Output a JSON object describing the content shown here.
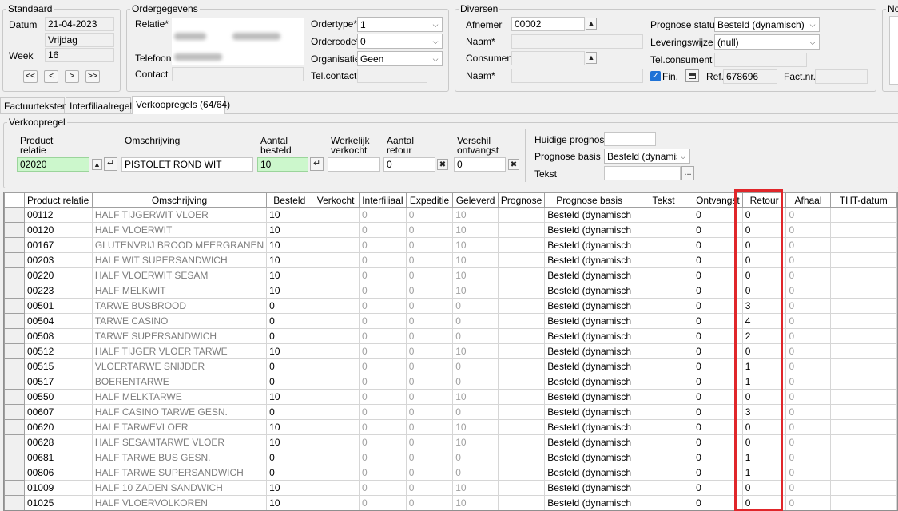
{
  "standaard": {
    "title": "Standaard",
    "datum_label": "Datum",
    "datum_value": "21-04-2023",
    "day_value": "Vrijdag",
    "week_label": "Week",
    "week_value": "16",
    "nav": [
      "<<",
      "<",
      ">",
      ">>"
    ]
  },
  "ordergegevens": {
    "title": "Ordergegevens",
    "relatie_label": "Relatie*",
    "telefoon_label": "Telefoon",
    "contact_label": "Contact",
    "ordertype_label": "Ordertype*",
    "ordertype_value": "1",
    "ordercode_label": "Ordercode*",
    "ordercode_value": "0",
    "organisatie_label": "Organisatie",
    "organisatie_value": "Geen",
    "telcontact_label": "Tel.contact"
  },
  "diversen": {
    "title": "Diversen",
    "afnemer_label": "Afnemer",
    "afnemer_value": "00002",
    "naam1_label": "Naam*",
    "consument_label": "Consument",
    "naam2_label": "Naam*",
    "prognose_status_label": "Prognose status",
    "prognose_status_value": "Besteld (dynamisch)",
    "leveringswijze_label": "Leveringswijze",
    "leveringswijze_value": "(null)",
    "telconsument_label": "Tel.consument",
    "fin_label": "Fin.",
    "ref_label": "Ref.",
    "ref_value": "678696",
    "factnr_label": "Fact.nr."
  },
  "notes_title": "No",
  "tabs": [
    {
      "label": "Factuurteksten"
    },
    {
      "label": "Interfiliaalregels"
    },
    {
      "label": "Verkoopregels (64/64)"
    }
  ],
  "verkoopregel": {
    "title": "Verkoopregel",
    "product_relatie_label_1": "Product",
    "product_relatie_label_2": "relatie",
    "product_relatie_value": "02020",
    "omschrijving_label": "Omschrijving",
    "omschrijving_value": "PISTOLET ROND WIT",
    "aantal_besteld_label_1": "Aantal",
    "aantal_besteld_label_2": "besteld",
    "aantal_besteld_value": "10",
    "werkelijk_label_1": "Werkelijk",
    "werkelijk_label_2": "verkocht",
    "werkelijk_value": "",
    "aantal_retour_label_1": "Aantal",
    "aantal_retour_label_2": "retour",
    "aantal_retour_value": "0",
    "verschil_label_1": "Verschil",
    "verschil_label_2": "ontvangst",
    "verschil_value": "0",
    "huidige_prognose_label": "Huidige prognose",
    "prognose_basis_label": "Prognose basis",
    "prognose_basis_value": "Besteld (dynamisc",
    "tekst_label": "Tekst",
    "tekst_button": "..."
  },
  "grid": {
    "columns": [
      "Product relatie",
      "Omschrijving",
      "Besteld",
      "Verkocht",
      "Interfiliaal",
      "Expeditie",
      "Geleverd",
      "Prognose",
      "Prognose basis",
      "Tekst",
      "Ontvangst",
      "Retour",
      "Afhaal",
      "THT-datum"
    ],
    "rows": [
      {
        "code": "00112",
        "desc": "HALF TIJGERWIT VLOER",
        "besteld": "10",
        "interfiliaal": "0",
        "expeditie": "0",
        "geleverd": "10",
        "basis": "Besteld (dynamisch",
        "ontvangst": "0",
        "retour": "0",
        "afhaal": "0"
      },
      {
        "code": "00120",
        "desc": "HALF VLOERWIT",
        "besteld": "10",
        "interfiliaal": "0",
        "expeditie": "0",
        "geleverd": "10",
        "basis": "Besteld (dynamisch",
        "ontvangst": "0",
        "retour": "0",
        "afhaal": "0"
      },
      {
        "code": "00167",
        "desc": "GLUTENVRIJ BROOD MEERGRANEN",
        "besteld": "10",
        "interfiliaal": "0",
        "expeditie": "0",
        "geleverd": "10",
        "basis": "Besteld (dynamisch",
        "ontvangst": "0",
        "retour": "0",
        "afhaal": "0"
      },
      {
        "code": "00203",
        "desc": "HALF WIT SUPERSANDWICH",
        "besteld": "10",
        "interfiliaal": "0",
        "expeditie": "0",
        "geleverd": "10",
        "basis": "Besteld (dynamisch",
        "ontvangst": "0",
        "retour": "0",
        "afhaal": "0"
      },
      {
        "code": "00220",
        "desc": "HALF VLOERWIT SESAM",
        "besteld": "10",
        "interfiliaal": "0",
        "expeditie": "0",
        "geleverd": "10",
        "basis": "Besteld (dynamisch",
        "ontvangst": "0",
        "retour": "0",
        "afhaal": "0"
      },
      {
        "code": "00223",
        "desc": "HALF MELKWIT",
        "besteld": "10",
        "interfiliaal": "0",
        "expeditie": "0",
        "geleverd": "10",
        "basis": "Besteld (dynamisch",
        "ontvangst": "0",
        "retour": "0",
        "afhaal": "0"
      },
      {
        "code": "00501",
        "desc": "TARWE BUSBROOD",
        "besteld": "0",
        "interfiliaal": "0",
        "expeditie": "0",
        "geleverd": "0",
        "basis": "Besteld (dynamisch",
        "ontvangst": "0",
        "retour": "3",
        "afhaal": "0"
      },
      {
        "code": "00504",
        "desc": "TARWE CASINO",
        "besteld": "0",
        "interfiliaal": "0",
        "expeditie": "0",
        "geleverd": "0",
        "basis": "Besteld (dynamisch",
        "ontvangst": "0",
        "retour": "4",
        "afhaal": "0"
      },
      {
        "code": "00508",
        "desc": "TARWE SUPERSANDWICH",
        "besteld": "0",
        "interfiliaal": "0",
        "expeditie": "0",
        "geleverd": "0",
        "basis": "Besteld (dynamisch",
        "ontvangst": "0",
        "retour": "2",
        "afhaal": "0"
      },
      {
        "code": "00512",
        "desc": "HALF TIJGER VLOER TARWE",
        "besteld": "10",
        "interfiliaal": "0",
        "expeditie": "0",
        "geleverd": "10",
        "basis": "Besteld (dynamisch",
        "ontvangst": "0",
        "retour": "0",
        "afhaal": "0"
      },
      {
        "code": "00515",
        "desc": "VLOERTARWE SNIJDER",
        "besteld": "0",
        "interfiliaal": "0",
        "expeditie": "0",
        "geleverd": "0",
        "basis": "Besteld (dynamisch",
        "ontvangst": "0",
        "retour": "1",
        "afhaal": "0"
      },
      {
        "code": "00517",
        "desc": "BOERENTARWE",
        "besteld": "0",
        "interfiliaal": "0",
        "expeditie": "0",
        "geleverd": "0",
        "basis": "Besteld (dynamisch",
        "ontvangst": "0",
        "retour": "1",
        "afhaal": "0"
      },
      {
        "code": "00550",
        "desc": "HALF MELKTARWE",
        "besteld": "10",
        "interfiliaal": "0",
        "expeditie": "0",
        "geleverd": "10",
        "basis": "Besteld (dynamisch",
        "ontvangst": "0",
        "retour": "0",
        "afhaal": "0"
      },
      {
        "code": "00607",
        "desc": "HALF CASINO TARWE GESN.",
        "besteld": "0",
        "interfiliaal": "0",
        "expeditie": "0",
        "geleverd": "0",
        "basis": "Besteld (dynamisch",
        "ontvangst": "0",
        "retour": "3",
        "afhaal": "0"
      },
      {
        "code": "00620",
        "desc": "HALF TARWEVLOER",
        "besteld": "10",
        "interfiliaal": "0",
        "expeditie": "0",
        "geleverd": "10",
        "basis": "Besteld (dynamisch",
        "ontvangst": "0",
        "retour": "0",
        "afhaal": "0"
      },
      {
        "code": "00628",
        "desc": "HALF SESAMTARWE VLOER",
        "besteld": "10",
        "interfiliaal": "0",
        "expeditie": "0",
        "geleverd": "10",
        "basis": "Besteld (dynamisch",
        "ontvangst": "0",
        "retour": "0",
        "afhaal": "0"
      },
      {
        "code": "00681",
        "desc": "HALF TARWE BUS GESN.",
        "besteld": "0",
        "interfiliaal": "0",
        "expeditie": "0",
        "geleverd": "0",
        "basis": "Besteld (dynamisch",
        "ontvangst": "0",
        "retour": "1",
        "afhaal": "0"
      },
      {
        "code": "00806",
        "desc": "HALF TARWE SUPERSANDWICH",
        "besteld": "0",
        "interfiliaal": "0",
        "expeditie": "0",
        "geleverd": "0",
        "basis": "Besteld (dynamisch",
        "ontvangst": "0",
        "retour": "1",
        "afhaal": "0"
      },
      {
        "code": "01009",
        "desc": "HALF 10 ZADEN SANDWICH",
        "besteld": "10",
        "interfiliaal": "0",
        "expeditie": "0",
        "geleverd": "10",
        "basis": "Besteld (dynamisch",
        "ontvangst": "0",
        "retour": "0",
        "afhaal": "0"
      },
      {
        "code": "01025",
        "desc": "HALF VLOERVOLKOREN",
        "besteld": "10",
        "interfiliaal": "0",
        "expeditie": "0",
        "geleverd": "10",
        "basis": "Besteld (dynamisch",
        "ontvangst": "0",
        "retour": "0",
        "afhaal": "0"
      }
    ]
  },
  "colors": {
    "highlight": "#e0262a",
    "green_field": "#ccf7cc",
    "checkbox": "#1e72d6"
  }
}
